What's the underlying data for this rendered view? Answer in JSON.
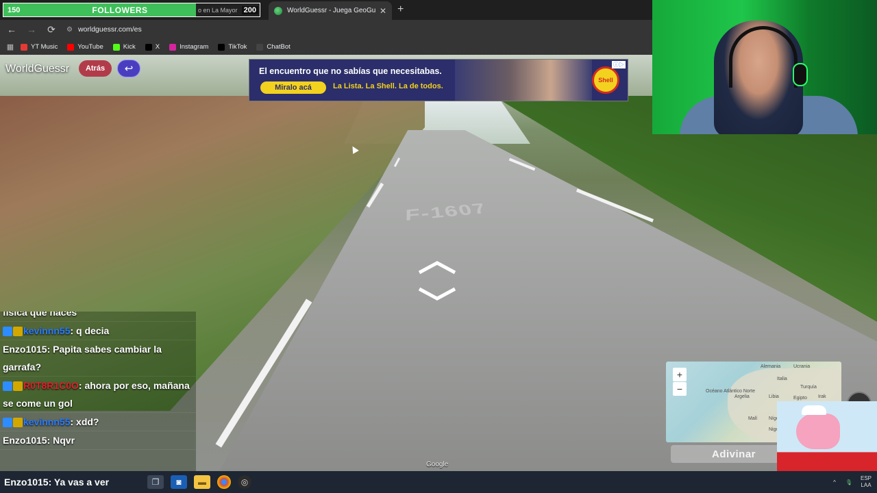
{
  "followers_widget": {
    "count": "150",
    "label": "FOLLOWERS",
    "ticker": "o en La Mayor",
    "goal": "200",
    "progress": 0.75
  },
  "tab": {
    "title": "WorldGuessr - Juega GeoGuessr",
    "close": "✕",
    "new_tab": "+"
  },
  "toolbar": {
    "back": "←",
    "forward": "→",
    "reload": "⟳",
    "url": "worldguessr.com/es"
  },
  "bookmarks": [
    {
      "label": "YT Music",
      "icon": "yt-music-icon",
      "color": "#e53935"
    },
    {
      "label": "YouTube",
      "icon": "youtube-icon",
      "color": "#ff0000"
    },
    {
      "label": "Kick",
      "icon": "kick-icon",
      "color": "#53fc18"
    },
    {
      "label": "X",
      "icon": "x-icon",
      "color": "#000000"
    },
    {
      "label": "Instagram",
      "icon": "instagram-icon",
      "color": "#d6249f"
    },
    {
      "label": "TikTok",
      "icon": "tiktok-icon",
      "color": "#000000"
    },
    {
      "label": "ChatBot",
      "icon": "chatbot-icon",
      "color": "#444444"
    }
  ],
  "game": {
    "logo": "WorldGuessr",
    "back_label": "Atrás",
    "return_icon": "↩",
    "road_text": "F-1607",
    "guess_label": "Adivinar",
    "google_mark": "Google",
    "zoom_in": "+",
    "zoom_out": "−"
  },
  "ad": {
    "headline": "El encuentro que no sabías que necesitabas.",
    "cta": "Miralo acá",
    "tagline": "La Lista. La Shell. La de todos.",
    "brand": "Shell"
  },
  "map_labels": [
    {
      "text": "Alemania"
    },
    {
      "text": "Ucrania"
    },
    {
      "text": "Italia"
    },
    {
      "text": "Turquía"
    },
    {
      "text": "Océano Atlántico Norte"
    },
    {
      "text": "Argelia"
    },
    {
      "text": "Libia"
    },
    {
      "text": "Egipto"
    },
    {
      "text": "Irak"
    },
    {
      "text": "Malí"
    },
    {
      "text": "Níger"
    },
    {
      "text": "Nigeria"
    }
  ],
  "chat": {
    "partial": "física que haces",
    "messages": [
      {
        "user": "kevinnn55",
        "user_color": "#2a7bff",
        "badges": true,
        "text": ": q decia"
      },
      {
        "user": "Enzo1015",
        "user_color": "#ffffff",
        "badges": false,
        "text": ": Papita sabes cambiar la garrafa?"
      },
      {
        "user": "R0T8R1C0O",
        "user_color": "#e3202c",
        "badges": true,
        "text": ": ahora por eso, mañana se come un gol"
      },
      {
        "user": "kevinnn55",
        "user_color": "#2a7bff",
        "badges": true,
        "text": ": xdd?"
      },
      {
        "user": "Enzo1015",
        "user_color": "#ffffff",
        "badges": false,
        "text": ": Nqvr"
      }
    ],
    "last": {
      "user": "Enzo1015",
      "text": ": Ya vas a ver"
    }
  },
  "taskbar": {
    "icons": [
      "task-view-icon",
      "outlook-icon",
      "file-explorer-icon",
      "chrome-icon",
      "obs-icon"
    ],
    "tray_up": "^",
    "lang_1": "ESP",
    "lang_2": "LAA"
  }
}
